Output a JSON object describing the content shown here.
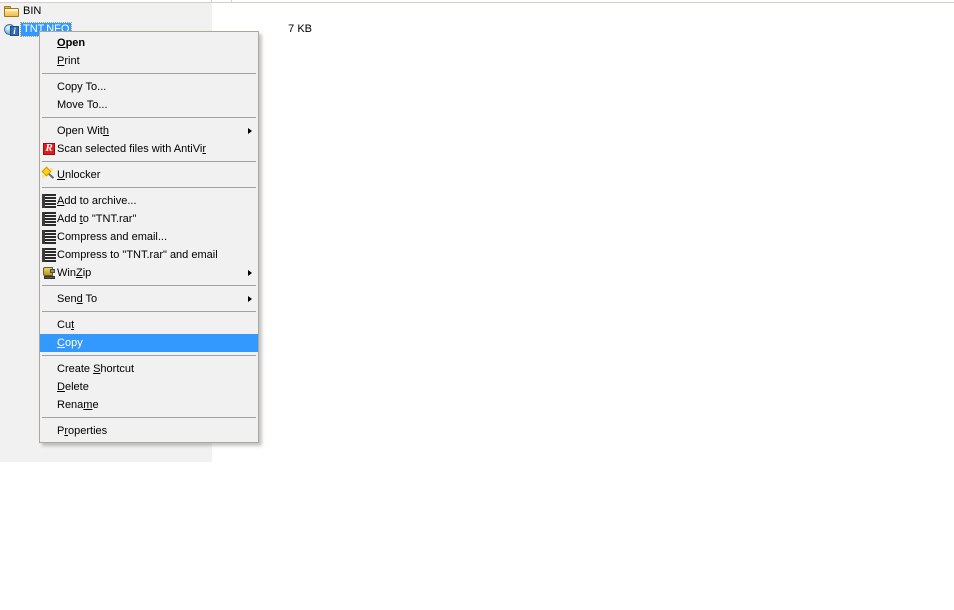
{
  "explorer": {
    "rows": [
      {
        "name": "BIN",
        "size": "",
        "icon": "folder-icon",
        "selected": false
      },
      {
        "name": "TNT.NFO",
        "size": "7 KB",
        "icon": "info-file-icon",
        "selected": true
      }
    ],
    "selection_color": "#3399ff",
    "selection_text_color": "#ffffff",
    "pane_background": "#ffffff",
    "left_band_background": "#f1f1f1"
  },
  "context_menu": {
    "background": "#f1f1f1",
    "border_color": "#aca899",
    "highlight_color": "#3399ff",
    "highlight_text_color": "#ffffff",
    "items": [
      {
        "type": "item",
        "label": "Open",
        "accel_index": 0,
        "bold": true,
        "icon": null,
        "submenu": false,
        "selected": false
      },
      {
        "type": "item",
        "label": "Print",
        "accel_index": 0,
        "bold": false,
        "icon": null,
        "submenu": false,
        "selected": false
      },
      {
        "type": "separator"
      },
      {
        "type": "item",
        "label": "Copy To...",
        "accel_index": -1,
        "bold": false,
        "icon": null,
        "submenu": false,
        "selected": false
      },
      {
        "type": "item",
        "label": "Move To...",
        "accel_index": -1,
        "bold": false,
        "icon": null,
        "submenu": false,
        "selected": false
      },
      {
        "type": "separator"
      },
      {
        "type": "item",
        "label": "Open With",
        "accel_index": 8,
        "bold": false,
        "icon": null,
        "submenu": true,
        "selected": false
      },
      {
        "type": "item",
        "label": "Scan selected files with AntiVir",
        "accel_index": 31,
        "bold": false,
        "icon": "antivir-icon",
        "submenu": false,
        "selected": false
      },
      {
        "type": "separator"
      },
      {
        "type": "item",
        "label": "Unlocker",
        "accel_index": 0,
        "bold": false,
        "icon": "wand-icon",
        "submenu": false,
        "selected": false
      },
      {
        "type": "separator"
      },
      {
        "type": "item",
        "label": "Add to archive...",
        "accel_index": 0,
        "bold": false,
        "icon": "books-icon",
        "submenu": false,
        "selected": false
      },
      {
        "type": "item",
        "label": "Add to \"TNT.rar\"",
        "accel_index": 4,
        "bold": false,
        "icon": "books-icon",
        "submenu": false,
        "selected": false
      },
      {
        "type": "item",
        "label": "Compress and email...",
        "accel_index": -1,
        "bold": false,
        "icon": "books-icon",
        "submenu": false,
        "selected": false
      },
      {
        "type": "item",
        "label": "Compress to \"TNT.rar\" and email",
        "accel_index": -1,
        "bold": false,
        "icon": "books-icon",
        "submenu": false,
        "selected": false
      },
      {
        "type": "item",
        "label": "WinZip",
        "accel_index": 3,
        "bold": false,
        "icon": "winzip-icon",
        "submenu": true,
        "selected": false
      },
      {
        "type": "separator"
      },
      {
        "type": "item",
        "label": "Send To",
        "accel_index": 3,
        "bold": false,
        "icon": null,
        "submenu": true,
        "selected": false
      },
      {
        "type": "separator"
      },
      {
        "type": "item",
        "label": "Cut",
        "accel_index": 2,
        "bold": false,
        "icon": null,
        "submenu": false,
        "selected": false
      },
      {
        "type": "item",
        "label": "Copy",
        "accel_index": 0,
        "bold": false,
        "icon": null,
        "submenu": false,
        "selected": true
      },
      {
        "type": "separator"
      },
      {
        "type": "item",
        "label": "Create Shortcut",
        "accel_index": 7,
        "bold": false,
        "icon": null,
        "submenu": false,
        "selected": false
      },
      {
        "type": "item",
        "label": "Delete",
        "accel_index": 0,
        "bold": false,
        "icon": null,
        "submenu": false,
        "selected": false
      },
      {
        "type": "item",
        "label": "Rename",
        "accel_index": 4,
        "bold": false,
        "icon": null,
        "submenu": false,
        "selected": false
      },
      {
        "type": "separator"
      },
      {
        "type": "item",
        "label": "Properties",
        "accel_index": 1,
        "bold": false,
        "icon": null,
        "submenu": false,
        "selected": false
      }
    ]
  }
}
